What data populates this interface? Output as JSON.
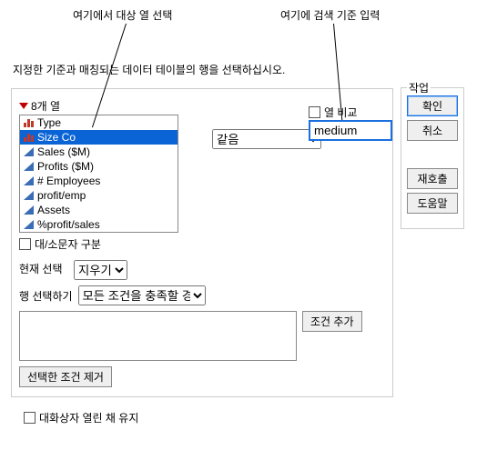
{
  "annotations": {
    "left": "여기에서 대상 열 선택",
    "right": "여기에 검색 기준 입력"
  },
  "instruction": "지정한 기준과 매칭되는 데이터 테이블의 행을 선택하십시오.",
  "columns": {
    "header": "8개 열",
    "items": [
      {
        "label": "Type",
        "icon": "bars"
      },
      {
        "label": "Size Co",
        "icon": "bars",
        "selected": true
      },
      {
        "label": "Sales ($M)",
        "icon": "tri"
      },
      {
        "label": "Profits ($M)",
        "icon": "tri"
      },
      {
        "label": "# Employees",
        "icon": "tri"
      },
      {
        "label": "profit/emp",
        "icon": "tri"
      },
      {
        "label": "Assets",
        "icon": "tri"
      },
      {
        "label": "%profit/sales",
        "icon": "tri"
      }
    ],
    "case_sensitive_label": "대/소문자 구분"
  },
  "operator": {
    "selected": "같음"
  },
  "compare": {
    "checkbox_label": "열 비교",
    "value": "medium"
  },
  "current_selection": {
    "label": "현재 선택",
    "clear_label": "지우기"
  },
  "row_select": {
    "label": "행 선택하기",
    "option": "모든 조건을 충족할 경우"
  },
  "conditions": {
    "add_label": "조건 추가",
    "remove_label": "선택한 조건 제거",
    "text": ""
  },
  "side": {
    "legend": "작업",
    "ok": "확인",
    "cancel": "취소",
    "recall": "재호출",
    "help": "도움말"
  },
  "keep_open_label": "대화상자 열린 채 유지"
}
